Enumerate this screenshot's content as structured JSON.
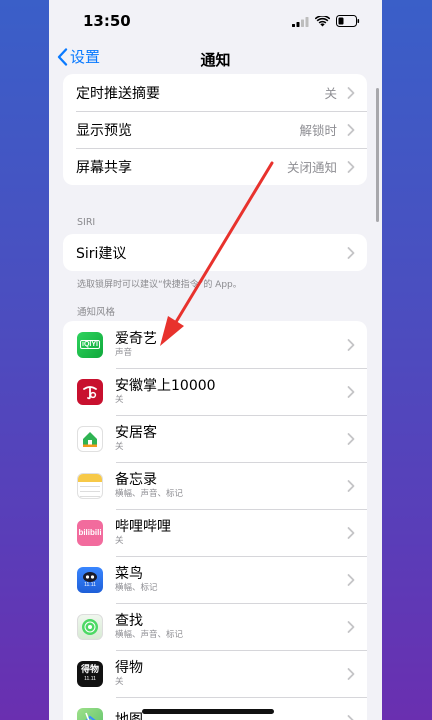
{
  "status_bar": {
    "time": "13:50"
  },
  "nav": {
    "back_label": "设置",
    "title": "通知"
  },
  "settings_rows": [
    {
      "label": "定时推送摘要",
      "value": "关"
    },
    {
      "label": "显示预览",
      "value": "解锁时"
    },
    {
      "label": "屏幕共享",
      "value": "关闭通知"
    }
  ],
  "siri": {
    "header": "SIRI",
    "row_label": "Siri建议",
    "footnote": "选取锁屏时可以建议“快捷指令”的 App。"
  },
  "notification_style": {
    "header": "通知风格",
    "apps": [
      {
        "name": "爱奇艺",
        "sub": "声音",
        "icon": "iqiyi-icon",
        "color": "#1ec14c"
      },
      {
        "name": "安徽掌上10000",
        "sub": "关",
        "icon": "china-telecom-icon",
        "color": "#c8102e"
      },
      {
        "name": "安居客",
        "sub": "关",
        "icon": "anjuke-icon",
        "color": "#2fb352"
      },
      {
        "name": "备忘录",
        "sub": "横幅、声音、标记",
        "icon": "notes-icon",
        "color": "#f7c948"
      },
      {
        "name": "哔哩哔哩",
        "sub": "关",
        "icon": "bilibili-icon",
        "color": "#f26b9d"
      },
      {
        "name": "菜鸟",
        "sub": "横幅、标记",
        "icon": "cainiao-icon",
        "color": "#1e6ee8"
      },
      {
        "name": "查找",
        "sub": "横幅、声音、标记",
        "icon": "find-my-icon",
        "color": "#4cd964"
      },
      {
        "name": "得物",
        "sub": "关",
        "icon": "dewu-icon",
        "color": "#111111"
      },
      {
        "name": "地图",
        "sub": "",
        "icon": "maps-icon",
        "color": "#5ec26a"
      }
    ]
  },
  "icon_text": {
    "iqiyi": "iQIYI",
    "bilibili": "bilibili",
    "dewu": "得物",
    "cainiao_badge": "11.11",
    "dewu_badge": "11.11"
  },
  "colors": {
    "accent": "#0a7aff",
    "annotation_arrow": "#e8322d"
  }
}
